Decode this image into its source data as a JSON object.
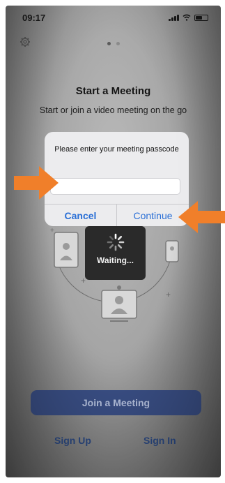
{
  "status_bar": {
    "time": "09:17"
  },
  "header": {
    "title": "Start a Meeting",
    "subtitle": "Start or join a video meeting on the go"
  },
  "dialog": {
    "message": "Please enter your meeting passcode",
    "passcode_value": "",
    "cancel_label": "Cancel",
    "continue_label": "Continue"
  },
  "waiting": {
    "label": "Waiting..."
  },
  "actions": {
    "join_label": "Join a Meeting",
    "sign_up_label": "Sign Up",
    "sign_in_label": "Sign In"
  },
  "colors": {
    "accent_blue": "#2a6fd6",
    "annotation_orange": "#f07f2a",
    "join_button_bg": "#3a4f86"
  },
  "icons": [
    "gear-icon",
    "signal-icon",
    "wifi-icon",
    "battery-icon",
    "spinner-icon"
  ]
}
